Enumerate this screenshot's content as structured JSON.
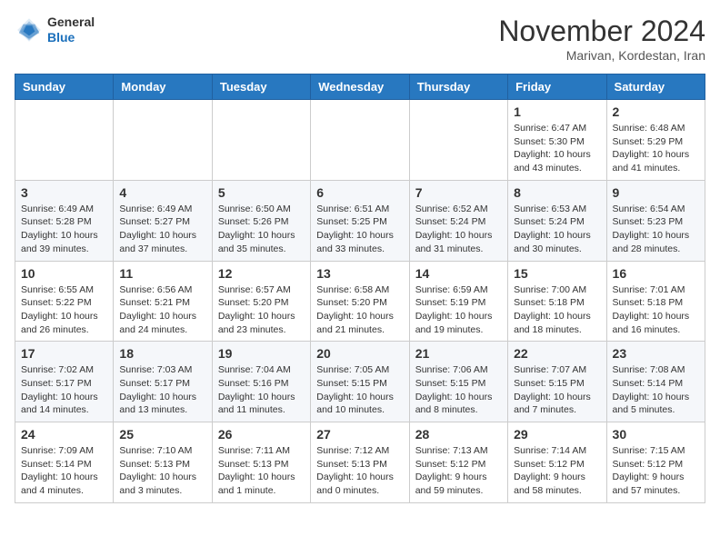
{
  "header": {
    "logo_general": "General",
    "logo_blue": "Blue",
    "month_title": "November 2024",
    "subtitle": "Marivan, Kordestan, Iran"
  },
  "days_of_week": [
    "Sunday",
    "Monday",
    "Tuesday",
    "Wednesday",
    "Thursday",
    "Friday",
    "Saturday"
  ],
  "weeks": [
    {
      "days": [
        {
          "num": "",
          "info": ""
        },
        {
          "num": "",
          "info": ""
        },
        {
          "num": "",
          "info": ""
        },
        {
          "num": "",
          "info": ""
        },
        {
          "num": "",
          "info": ""
        },
        {
          "num": "1",
          "info": "Sunrise: 6:47 AM\nSunset: 5:30 PM\nDaylight: 10 hours\nand 43 minutes."
        },
        {
          "num": "2",
          "info": "Sunrise: 6:48 AM\nSunset: 5:29 PM\nDaylight: 10 hours\nand 41 minutes."
        }
      ]
    },
    {
      "days": [
        {
          "num": "3",
          "info": "Sunrise: 6:49 AM\nSunset: 5:28 PM\nDaylight: 10 hours\nand 39 minutes."
        },
        {
          "num": "4",
          "info": "Sunrise: 6:49 AM\nSunset: 5:27 PM\nDaylight: 10 hours\nand 37 minutes."
        },
        {
          "num": "5",
          "info": "Sunrise: 6:50 AM\nSunset: 5:26 PM\nDaylight: 10 hours\nand 35 minutes."
        },
        {
          "num": "6",
          "info": "Sunrise: 6:51 AM\nSunset: 5:25 PM\nDaylight: 10 hours\nand 33 minutes."
        },
        {
          "num": "7",
          "info": "Sunrise: 6:52 AM\nSunset: 5:24 PM\nDaylight: 10 hours\nand 31 minutes."
        },
        {
          "num": "8",
          "info": "Sunrise: 6:53 AM\nSunset: 5:24 PM\nDaylight: 10 hours\nand 30 minutes."
        },
        {
          "num": "9",
          "info": "Sunrise: 6:54 AM\nSunset: 5:23 PM\nDaylight: 10 hours\nand 28 minutes."
        }
      ]
    },
    {
      "days": [
        {
          "num": "10",
          "info": "Sunrise: 6:55 AM\nSunset: 5:22 PM\nDaylight: 10 hours\nand 26 minutes."
        },
        {
          "num": "11",
          "info": "Sunrise: 6:56 AM\nSunset: 5:21 PM\nDaylight: 10 hours\nand 24 minutes."
        },
        {
          "num": "12",
          "info": "Sunrise: 6:57 AM\nSunset: 5:20 PM\nDaylight: 10 hours\nand 23 minutes."
        },
        {
          "num": "13",
          "info": "Sunrise: 6:58 AM\nSunset: 5:20 PM\nDaylight: 10 hours\nand 21 minutes."
        },
        {
          "num": "14",
          "info": "Sunrise: 6:59 AM\nSunset: 5:19 PM\nDaylight: 10 hours\nand 19 minutes."
        },
        {
          "num": "15",
          "info": "Sunrise: 7:00 AM\nSunset: 5:18 PM\nDaylight: 10 hours\nand 18 minutes."
        },
        {
          "num": "16",
          "info": "Sunrise: 7:01 AM\nSunset: 5:18 PM\nDaylight: 10 hours\nand 16 minutes."
        }
      ]
    },
    {
      "days": [
        {
          "num": "17",
          "info": "Sunrise: 7:02 AM\nSunset: 5:17 PM\nDaylight: 10 hours\nand 14 minutes."
        },
        {
          "num": "18",
          "info": "Sunrise: 7:03 AM\nSunset: 5:17 PM\nDaylight: 10 hours\nand 13 minutes."
        },
        {
          "num": "19",
          "info": "Sunrise: 7:04 AM\nSunset: 5:16 PM\nDaylight: 10 hours\nand 11 minutes."
        },
        {
          "num": "20",
          "info": "Sunrise: 7:05 AM\nSunset: 5:15 PM\nDaylight: 10 hours\nand 10 minutes."
        },
        {
          "num": "21",
          "info": "Sunrise: 7:06 AM\nSunset: 5:15 PM\nDaylight: 10 hours\nand 8 minutes."
        },
        {
          "num": "22",
          "info": "Sunrise: 7:07 AM\nSunset: 5:15 PM\nDaylight: 10 hours\nand 7 minutes."
        },
        {
          "num": "23",
          "info": "Sunrise: 7:08 AM\nSunset: 5:14 PM\nDaylight: 10 hours\nand 5 minutes."
        }
      ]
    },
    {
      "days": [
        {
          "num": "24",
          "info": "Sunrise: 7:09 AM\nSunset: 5:14 PM\nDaylight: 10 hours\nand 4 minutes."
        },
        {
          "num": "25",
          "info": "Sunrise: 7:10 AM\nSunset: 5:13 PM\nDaylight: 10 hours\nand 3 minutes."
        },
        {
          "num": "26",
          "info": "Sunrise: 7:11 AM\nSunset: 5:13 PM\nDaylight: 10 hours\nand 1 minute."
        },
        {
          "num": "27",
          "info": "Sunrise: 7:12 AM\nSunset: 5:13 PM\nDaylight: 10 hours\nand 0 minutes."
        },
        {
          "num": "28",
          "info": "Sunrise: 7:13 AM\nSunset: 5:12 PM\nDaylight: 9 hours\nand 59 minutes."
        },
        {
          "num": "29",
          "info": "Sunrise: 7:14 AM\nSunset: 5:12 PM\nDaylight: 9 hours\nand 58 minutes."
        },
        {
          "num": "30",
          "info": "Sunrise: 7:15 AM\nSunset: 5:12 PM\nDaylight: 9 hours\nand 57 minutes."
        }
      ]
    }
  ]
}
